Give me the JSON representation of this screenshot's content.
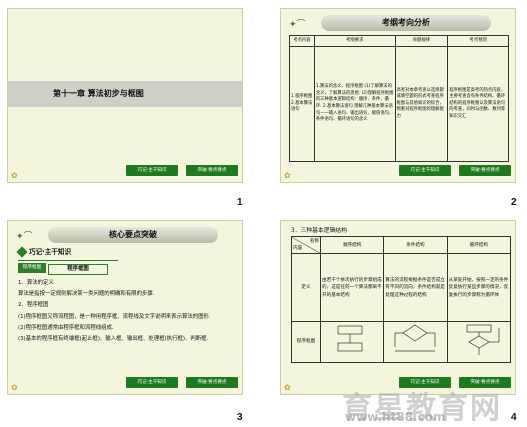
{
  "slides": [
    {
      "number": "1",
      "title": "第十一章  算法初步与框图",
      "buttons": [
        "巧记·主干知识",
        "突破·要点要点"
      ]
    },
    {
      "number": "2",
      "header": "考纲考向分析",
      "table": {
        "headers": [
          "考点内容",
          "考纲要求",
          "命题规律",
          "考点预测"
        ],
        "col1": "1.程序框图   2.基本算法语句",
        "col2": "1.算法的含义、程序框图  (1)了解算法的含义，了解算法的思想.  (2)理解程序框图的三种基本逻辑结构：顺序、条件、循环.  2.基本算法语句  理解几种基本算法语句——输入语句、输出语句、赋值语句、条件语句、循环语句的含义",
        "col3": "高考对本章考查以选择题或填空题的形式考查程序框图与其他知识的综合，侧重对程序框图的理解能力",
        "col4": "程序框图是高考的热点内容，主要考查含有条件结构、循环结构的程序框图以及算法语句的考查，同时与函数、数列等知识交汇"
      },
      "buttons": [
        "巧记·主干知识",
        "突破·要点要点"
      ]
    },
    {
      "number": "3",
      "header": "核心要点突破",
      "subtitle": "巧记·主干知识",
      "label": "程序框图",
      "tag": "程序框图",
      "lines": [
        "1．算法的定义",
        "算法是指按一定规则解决某一类问题的明确和有限的步骤.",
        "2．程序框图",
        "(1)程序框图又称流程图，是一种用程序框、流程线及文字说明来表示算法的图形.",
        "(2)程序框图通常由程序框和流程线组成.",
        "(3)基本的程序框有终端框(起止框)、输入框、输出框、处理框(执行框)、判断框."
      ],
      "buttons": [
        "巧记·主干知识",
        "突破·要点要点"
      ]
    },
    {
      "number": "4",
      "title": "3．三种基本逻辑结构",
      "table": {
        "corner_top": "名称",
        "corner_bottom": "内容",
        "headers": [
          "顺序结构",
          "条件结构",
          "循环结构"
        ],
        "row1_label": "定义",
        "row1": [
          "由若干个依次执行的步骤组成的，这是任何一个算法都离不开的基本结构",
          "算法的流程根据条件是否成立有不同的流向，条件结构就是处理这种过程的结构",
          "从某处开始，按照一定的条件反复执行某些步骤的情况，反复执行的步骤称为循环体"
        ],
        "row2_label": "程序框图"
      },
      "buttons": [
        "巧记·主干知识",
        "突破·要点要点"
      ]
    }
  ],
  "watermark": {
    "text": "育星教育网",
    "url": "www.ht88.com"
  }
}
